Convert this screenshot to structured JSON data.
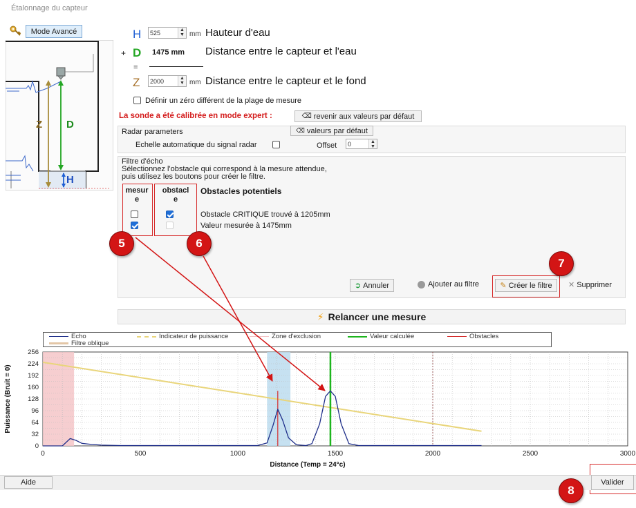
{
  "window": {
    "title": "Étalonnage du capteur"
  },
  "mode_button": "Mode Avancé",
  "diagram": {
    "z": "Z",
    "d": "D",
    "h": "H"
  },
  "params": {
    "h": {
      "letter": "H",
      "value": "525",
      "unit": "mm",
      "label": "Hauteur d'eau"
    },
    "d": {
      "plus": "+",
      "letter": "D",
      "value": "1475 mm",
      "label": "Distance entre le capteur et l'eau"
    },
    "eq": "=",
    "z": {
      "letter": "Z",
      "value": "2000",
      "unit": "mm",
      "label": "Distance entre le capteur et le fond"
    }
  },
  "zero_checkbox": "Définir un zéro différent de la plage de mesure",
  "expert_notice": "La sonde a été calibrée en mode expert :",
  "reset_button": "revenir aux valeurs par défaut",
  "radar": {
    "title": "Radar parameters",
    "defaults_button": "valeurs par défaut",
    "auto_scale_label": "Echelle automatique du signal radar",
    "offset_label": "Offset",
    "offset_value": "0"
  },
  "echo_filter": {
    "title": "Filtre d'écho",
    "line1": "Sélectionnez l'obstacle qui correspond à la mesure attendue,",
    "line2": "puis utilisez les boutons pour créer le filtre.",
    "col_mesure": [
      "mesur",
      "e"
    ],
    "col_obstacle": [
      "obstacl",
      "e"
    ],
    "col_potentials": "Obstacles potentiels",
    "rows": [
      {
        "text": "Obstacle CRITIQUE trouvé à 1205mm",
        "mesure": false,
        "obstacle": true
      },
      {
        "text": "Valeur mesurée à 1475mm",
        "mesure": true,
        "obstacle": false
      }
    ],
    "buttons": {
      "cancel": "Annuler",
      "add": "Ajouter au filtre",
      "create": "Créer le filtre",
      "delete": "Supprimer"
    }
  },
  "relaunch_button": "Relancer une mesure",
  "legend": {
    "echo": "Echo",
    "oblique": "Filtre oblique",
    "power": "Indicateur de puissance",
    "exclusion": "Zone d'exclusion",
    "computed": "Valeur calculée",
    "obstacles": "Obstacles"
  },
  "colors": {
    "echo": "#1f2f8a",
    "power": "#e9d57a",
    "exclusion": "#f5c6c8",
    "computed": "#1db51d",
    "obstacles": "#d42a2a",
    "obstacle_zone": "#bcdcee",
    "marker": "#d31515"
  },
  "chart_data": {
    "type": "line",
    "xlabel": "Distance (Temp = 24°c)",
    "ylabel": "Puissance (Bruit = 0)",
    "xlim": [
      0,
      3000
    ],
    "ylim": [
      0,
      256
    ],
    "xticks": [
      0,
      500,
      1000,
      1500,
      2000,
      2500,
      3000
    ],
    "yticks": [
      0,
      32,
      64,
      96,
      128,
      160,
      192,
      224,
      256
    ],
    "grid": true,
    "legend_position": "top",
    "series": [
      {
        "name": "Echo",
        "x": [
          0,
          100,
          140,
          170,
          200,
          250,
          300,
          400,
          1100,
          1150,
          1180,
          1205,
          1230,
          1260,
          1300,
          1350,
          1380,
          1420,
          1450,
          1475,
          1500,
          1530,
          1570,
          1620,
          2250
        ],
        "y": [
          0,
          0,
          20,
          15,
          7,
          4,
          2,
          1,
          1,
          8,
          55,
          100,
          70,
          22,
          3,
          1,
          6,
          60,
          135,
          150,
          135,
          60,
          6,
          1,
          1
        ]
      },
      {
        "name": "Indicateur de puissance",
        "x": [
          0,
          2250
        ],
        "y": [
          228,
          40
        ]
      }
    ],
    "exclusion_zone": [
      0,
      160
    ],
    "obstacle_zone": [
      1150,
      1270
    ],
    "computed_value": 1475,
    "obstacles": [
      1205
    ],
    "oblique_filter_x": 2000
  },
  "annotations": [
    "5",
    "6",
    "7",
    "8"
  ],
  "footer": {
    "help": "Aide",
    "validate": "Valider"
  }
}
